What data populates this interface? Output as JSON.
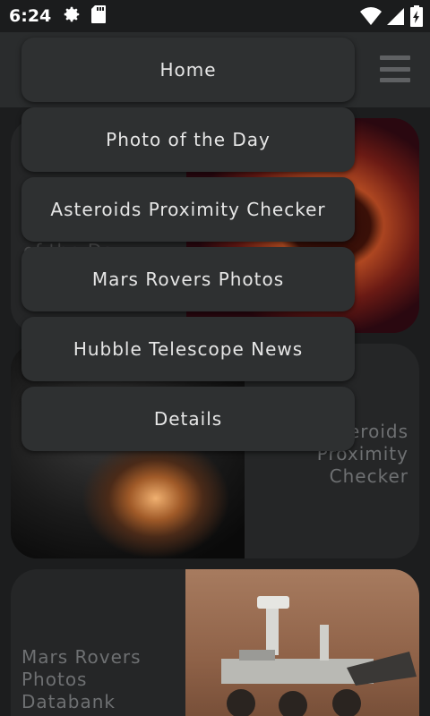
{
  "status_bar": {
    "time": "6:24",
    "icons": [
      "gear-icon",
      "sd-card-icon",
      "wifi-icon",
      "signal-icon",
      "battery-charging-icon"
    ]
  },
  "app_bar": {
    "menu_icon": "hamburger-menu-icon"
  },
  "menu": {
    "items": [
      {
        "label": "Home"
      },
      {
        "label": "Photo of the Day"
      },
      {
        "label": "Asteroids Proximity Checker"
      },
      {
        "label": "Mars Rovers Photos"
      },
      {
        "label": "Hubble Telescope News"
      },
      {
        "label": "Details"
      }
    ]
  },
  "cards": [
    {
      "label": "of the Day",
      "image": "nebula-photo"
    },
    {
      "label_lines": [
        "Asteroids",
        "Proximity",
        "Checker"
      ],
      "image": "galaxy-photo"
    },
    {
      "label_lines": [
        "Mars Rovers",
        "Photos",
        "Databank"
      ],
      "image": "mars-rover-photo"
    }
  ],
  "colors": {
    "background": "#1c1d1e",
    "app_bar": "#2a2c2d",
    "menu_item_bg": "#2e3031",
    "menu_text": "#e6e6e6",
    "card_bg": "#252627",
    "card_text": "#6e7072"
  }
}
